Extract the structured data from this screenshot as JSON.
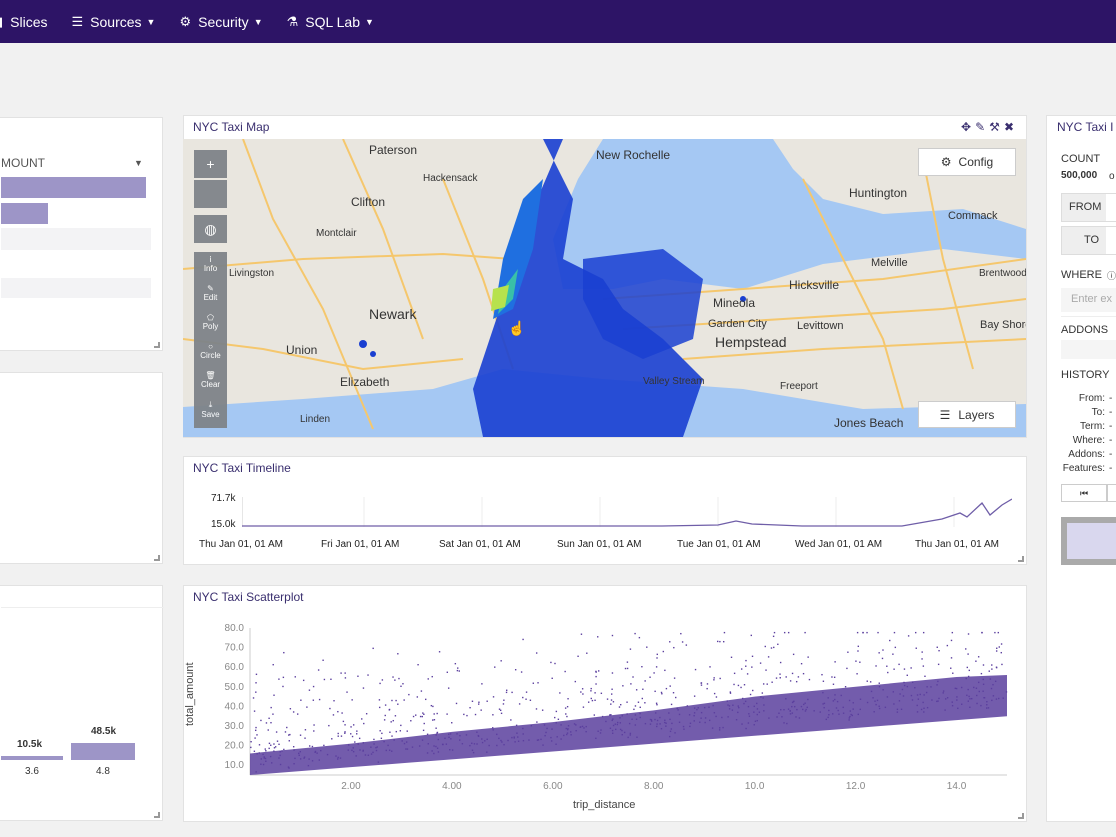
{
  "nav": {
    "items": [
      {
        "label": "Slices",
        "icon": "bar-chart-icon",
        "glyph": "▮",
        "caret": false
      },
      {
        "label": "Sources",
        "icon": "database-icon",
        "glyph": "☰",
        "caret": true
      },
      {
        "label": "Security",
        "icon": "gears-icon",
        "glyph": "⚙",
        "caret": true
      },
      {
        "label": "SQL Lab",
        "icon": "flask-icon",
        "glyph": "⚗",
        "caret": true
      }
    ]
  },
  "left_panel_top": {
    "label": "MOUNT"
  },
  "left_panel_bottom": {
    "bars": [
      {
        "value": "10.5k",
        "label": "3.6"
      },
      {
        "value": "48.5k",
        "label": "4.8"
      }
    ]
  },
  "map": {
    "title": "NYC Taxi Map",
    "config_label": "Config",
    "layers_label": "Layers",
    "zoom_in": "+",
    "toolbar": [
      "Info",
      "Edit",
      "Poly",
      "Circle",
      "Clear",
      "Save"
    ],
    "places": [
      {
        "name": "Paterson"
      },
      {
        "name": "Hackensack"
      },
      {
        "name": "New Rochelle"
      },
      {
        "name": "Clifton"
      },
      {
        "name": "Montclair"
      },
      {
        "name": "Livingston"
      },
      {
        "name": "Newark"
      },
      {
        "name": "Union"
      },
      {
        "name": "Elizabeth"
      },
      {
        "name": "Linden"
      },
      {
        "name": "Huntington"
      },
      {
        "name": "Commack"
      },
      {
        "name": "Hicksville"
      },
      {
        "name": "Melville"
      },
      {
        "name": "Brentwood"
      },
      {
        "name": "Mineola"
      },
      {
        "name": "Garden City"
      },
      {
        "name": "Hempstead"
      },
      {
        "name": "Levittown"
      },
      {
        "name": "Bay Shore"
      },
      {
        "name": "Freeport"
      },
      {
        "name": "Valley Stream"
      },
      {
        "name": "Jones Beach"
      }
    ]
  },
  "timeline": {
    "title": "NYC Taxi Timeline",
    "y_max": "71.7k",
    "y_min": "15.0k",
    "x_ticks": [
      "Thu Jan 01, 01 AM",
      "Fri Jan 01, 01 AM",
      "Sat Jan 01, 01 AM",
      "Sun Jan 01, 01 AM",
      "Tue Jan 01, 01 AM",
      "Wed Jan 01, 01 AM",
      "Thu Jan 01, 01 AM"
    ]
  },
  "scatter": {
    "title": "NYC Taxi Scatterplot",
    "xlabel": "trip_distance",
    "ylabel": "total_amount",
    "x_ticks": [
      "2.00",
      "4.00",
      "6.00",
      "8.00",
      "10.0",
      "12.0",
      "14.0"
    ],
    "y_ticks": [
      "80.0",
      "70.0",
      "60.0",
      "50.0",
      "40.0",
      "30.0",
      "20.0",
      "10.0"
    ],
    "color": "#5b3f9e"
  },
  "side": {
    "title": "NYC Taxi I",
    "count_label": "COUNT",
    "count_value": "500,000",
    "count_suffix": "o",
    "from_label": "FROM",
    "to_label": "TO",
    "where_label": "WHERE",
    "where_placeholder": "Enter ex",
    "addons_label": "ADDONS",
    "history_label": "HISTORY",
    "history_rows": [
      {
        "k": "From:",
        "v": "-"
      },
      {
        "k": "To:",
        "v": "-"
      },
      {
        "k": "Term:",
        "v": "-"
      },
      {
        "k": "Where:",
        "v": "-"
      },
      {
        "k": "Addons:",
        "v": "-"
      },
      {
        "k": "Features:",
        "v": "-"
      }
    ]
  },
  "colors": {
    "nav_bg": "#2d1466",
    "accent": "#5b3f9e",
    "bar": "#9d95c7"
  }
}
